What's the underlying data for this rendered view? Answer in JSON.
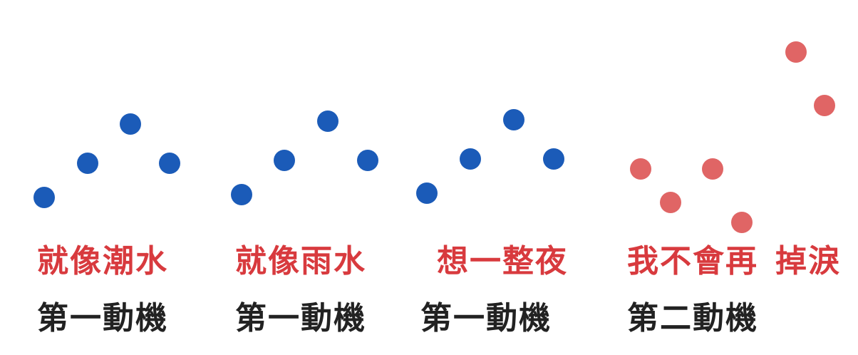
{
  "colors": {
    "motif_one_dot": "#1b5bb8",
    "motif_two_dot": "#e06565",
    "lyric_text": "#d83a3e",
    "motif_text": "#222222"
  },
  "groups": [
    {
      "lyric": "就像潮水",
      "motif": "第一動機",
      "color": "motif_one",
      "pitch_pattern": [
        1,
        2,
        3,
        2
      ]
    },
    {
      "lyric": "就像雨水",
      "motif": "第一動機",
      "color": "motif_one",
      "pitch_pattern": [
        1,
        2,
        3,
        2
      ]
    },
    {
      "lyric": "想一整夜",
      "motif": "第一動機",
      "color": "motif_one",
      "pitch_pattern": [
        1,
        2,
        3,
        2
      ]
    },
    {
      "lyric": "我不會再",
      "motif": "第二動機",
      "color": "motif_two",
      "pitch_pattern": [
        3,
        2,
        3,
        1
      ]
    },
    {
      "lyric": "掉淚",
      "motif": "",
      "color": "motif_two",
      "pitch_pattern": [
        5,
        4
      ]
    }
  ]
}
